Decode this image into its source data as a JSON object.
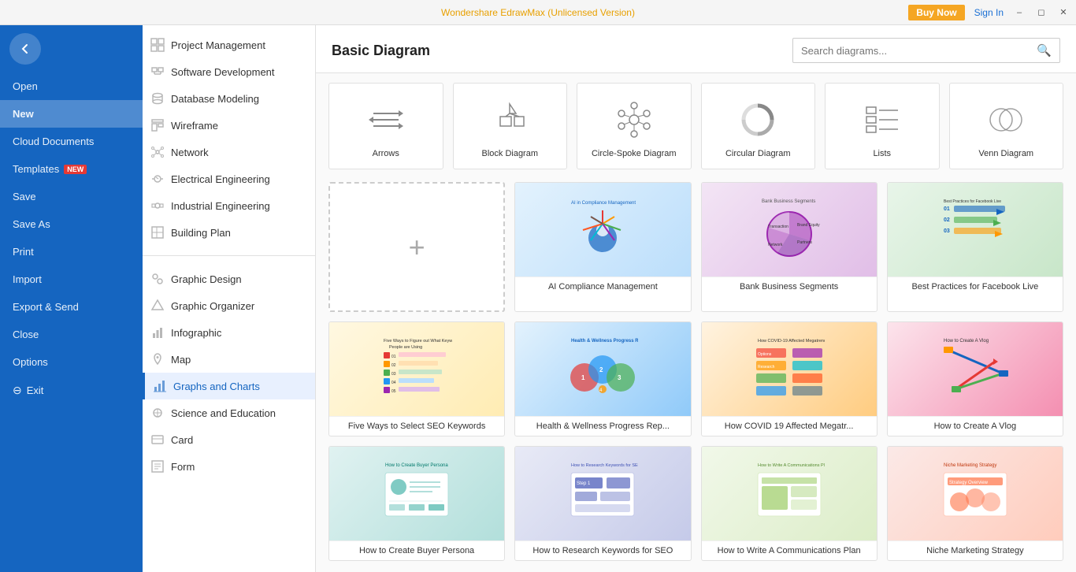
{
  "titlebar": {
    "app_name": "Wondershare EdrawMax",
    "version_label": "(Unlicensed Version)",
    "buy_now_label": "Buy Now",
    "sign_in_label": "Sign In"
  },
  "sidebar": {
    "items": [
      {
        "id": "open",
        "label": "Open"
      },
      {
        "id": "new",
        "label": "New",
        "active": true
      },
      {
        "id": "cloud",
        "label": "Cloud Documents"
      },
      {
        "id": "templates",
        "label": "Templates",
        "badge": "NEW"
      },
      {
        "id": "save",
        "label": "Save"
      },
      {
        "id": "save-as",
        "label": "Save As"
      },
      {
        "id": "print",
        "label": "Print"
      },
      {
        "id": "import",
        "label": "Import"
      },
      {
        "id": "export",
        "label": "Export & Send"
      },
      {
        "id": "close",
        "label": "Close"
      },
      {
        "id": "options",
        "label": "Options"
      },
      {
        "id": "exit",
        "label": "Exit"
      }
    ]
  },
  "nav": {
    "sections": [
      {
        "items": [
          {
            "id": "project-mgmt",
            "label": "Project Management"
          },
          {
            "id": "software-dev",
            "label": "Software Development"
          },
          {
            "id": "db-modeling",
            "label": "Database Modeling"
          },
          {
            "id": "wireframe",
            "label": "Wireframe"
          },
          {
            "id": "network",
            "label": "Network"
          },
          {
            "id": "electrical-eng",
            "label": "Electrical Engineering"
          },
          {
            "id": "industrial-eng",
            "label": "Industrial Engineering"
          },
          {
            "id": "building-plan",
            "label": "Building Plan"
          }
        ]
      },
      {
        "items": [
          {
            "id": "graphic-design",
            "label": "Graphic Design"
          },
          {
            "id": "graphic-organizer",
            "label": "Graphic Organizer"
          },
          {
            "id": "infographic",
            "label": "Infographic"
          },
          {
            "id": "map",
            "label": "Map"
          },
          {
            "id": "graphs-charts",
            "label": "Graphs and Charts",
            "selected": true
          },
          {
            "id": "science-edu",
            "label": "Science and Education"
          },
          {
            "id": "card",
            "label": "Card"
          },
          {
            "id": "form",
            "label": "Form"
          }
        ]
      }
    ]
  },
  "content": {
    "title": "Basic Diagram",
    "search_placeholder": "Search diagrams...",
    "basic_diagrams": [
      {
        "id": "arrows",
        "label": "Arrows"
      },
      {
        "id": "block-diagram",
        "label": "Block Diagram"
      },
      {
        "id": "circle-spoke",
        "label": "Circle-Spoke Diagram"
      },
      {
        "id": "circular",
        "label": "Circular Diagram"
      },
      {
        "id": "lists",
        "label": "Lists"
      },
      {
        "id": "venn",
        "label": "Venn Diagram"
      }
    ],
    "templates": [
      {
        "id": "new",
        "label": "",
        "type": "new"
      },
      {
        "id": "ai-compliance",
        "label": "AI Compliance Management",
        "type": "tmpl-ai"
      },
      {
        "id": "bank-segments",
        "label": "Bank Business Segments",
        "type": "tmpl-bank"
      },
      {
        "id": "fb-live",
        "label": "Best Practices for Facebook Live",
        "type": "tmpl-fb"
      },
      {
        "id": "seo-keywords",
        "label": "Five Ways to Select SEO Keywords",
        "type": "tmpl-seo"
      },
      {
        "id": "health-wellness",
        "label": "Health & Wellness Progress Rep...",
        "type": "tmpl-health"
      },
      {
        "id": "covid",
        "label": "How COVID 19 Affected Megatr...",
        "type": "tmpl-covid"
      },
      {
        "id": "vlog",
        "label": "How to Create A Vlog",
        "type": "tmpl-vlog"
      },
      {
        "id": "buyer-persona",
        "label": "How to Create Buyer Persona",
        "type": "tmpl-buyer"
      },
      {
        "id": "research-seo",
        "label": "How to Research Keywords for SEO",
        "type": "tmpl-research"
      },
      {
        "id": "comms-plan",
        "label": "How to Write A Communications Plan",
        "type": "tmpl-comms"
      },
      {
        "id": "niche-marketing",
        "label": "Niche Marketing Strategy",
        "type": "tmpl-niche"
      }
    ]
  }
}
